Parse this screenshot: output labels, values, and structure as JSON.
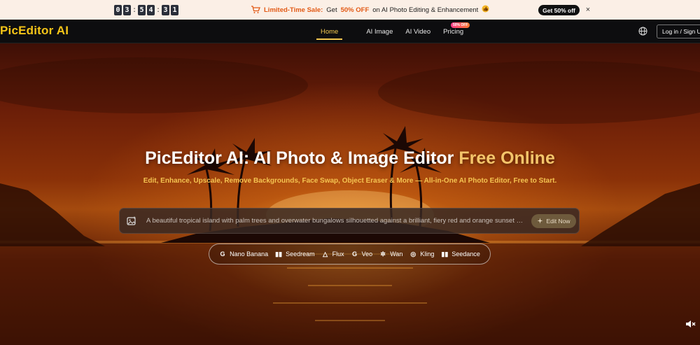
{
  "promo": {
    "countdown": [
      "0",
      "3",
      "5",
      "4",
      "3",
      "1"
    ],
    "sale_label": "Limited-Time Sale:",
    "get_text": "Get",
    "discount": "50% OFF",
    "tail": "on AI Photo Editing & Enhancement",
    "cta": "Get 50% off",
    "close": "×"
  },
  "nav": {
    "logo": "PicEditor AI",
    "links": [
      "Home",
      "AI Image",
      "AI Video",
      "Pricing"
    ],
    "badge": "50% OFF",
    "login": "Log in / Sign Up"
  },
  "hero": {
    "title_a": "PicEditor AI: AI Photo & Image Editor",
    "title_b": "Free Online",
    "subtitle": "Edit, Enhance, Upscale, Remove Backgrounds, Face Swap, Object Eraser & More — All-in-One AI Photo Editor, Free to Start.",
    "prompt": "A beautiful tropical island with palm trees and overwater bungalows silhouetted against a brilliant, fiery red and orange sunset sky",
    "edit_button": "Edit Now",
    "models": [
      {
        "icon": "G",
        "name": "Nano Banana"
      },
      {
        "icon": "▮▮",
        "name": "Seedream"
      },
      {
        "icon": "△",
        "name": "Flux"
      },
      {
        "icon": "G",
        "name": "Veo"
      },
      {
        "icon": "✲",
        "name": "Wan"
      },
      {
        "icon": "◎",
        "name": "Kling"
      },
      {
        "icon": "▮▮",
        "name": "Seedance"
      }
    ]
  },
  "colors": {
    "accent": "#f3c850",
    "promo_bg": "#fbefe6",
    "nav_bg": "#0d0d0f",
    "orange": "#e25a16"
  }
}
